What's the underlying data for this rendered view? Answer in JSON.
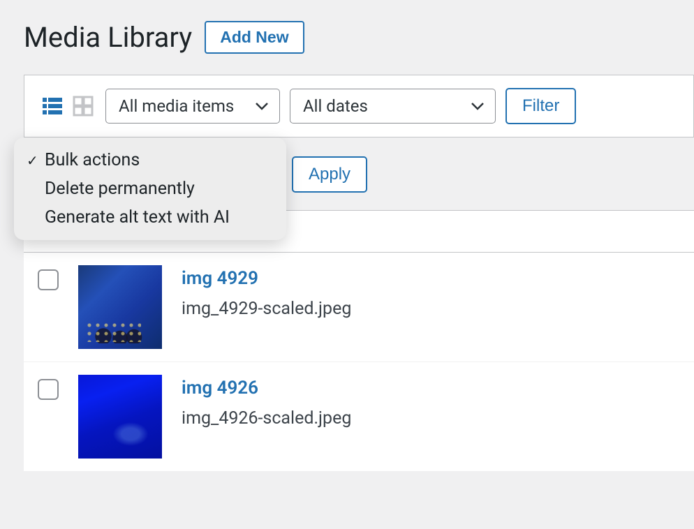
{
  "header": {
    "title": "Media Library",
    "add_new_label": "Add New"
  },
  "filters": {
    "media_type_selected": "All media items",
    "date_selected": "All dates",
    "filter_button_label": "Filter"
  },
  "bulk": {
    "apply_label": "Apply",
    "dropdown_open": true,
    "options": [
      {
        "label": "Bulk actions",
        "checked": true
      },
      {
        "label": "Delete permanently",
        "checked": false
      },
      {
        "label": "Generate alt text with AI",
        "checked": false
      }
    ]
  },
  "media_items": [
    {
      "title": "img 4929",
      "filename": "img_4929-scaled.jpeg"
    },
    {
      "title": "img 4926",
      "filename": "img_4926-scaled.jpeg"
    }
  ]
}
